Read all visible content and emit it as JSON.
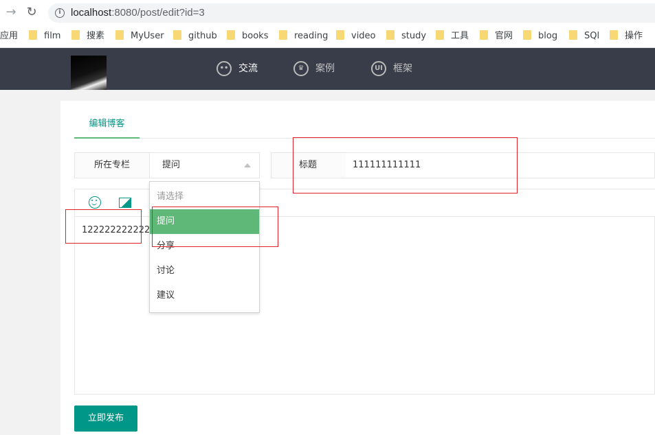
{
  "browser": {
    "url_host": "localhost",
    "url_rest": ":8080/post/edit?id=3",
    "bookmarks": [
      "应用",
      "film",
      "搜素",
      "MyUser",
      "github",
      "books",
      "reading",
      "video",
      "study",
      "工具",
      "官网",
      "blog",
      "SQl",
      "操作"
    ]
  },
  "header": {
    "nav": [
      {
        "label": "交流",
        "icon": "chat-icon"
      },
      {
        "label": "案例",
        "icon": "crown-icon"
      },
      {
        "label": "框架",
        "icon": "ui-icon"
      }
    ]
  },
  "form": {
    "tab_label": "编辑博客",
    "column_label": "所在专栏",
    "column_value": "提问",
    "title_label": "标题",
    "title_value": "111111111111",
    "editor_content": "122222222222222",
    "dropdown_options": [
      "请选择",
      "提问",
      "分享",
      "讨论",
      "建议"
    ],
    "publish_label": "立即发布"
  },
  "colors": {
    "accent": "#009688",
    "selected": "#5fb878",
    "header_bg": "#393d49",
    "annotation": "#e0202a"
  }
}
